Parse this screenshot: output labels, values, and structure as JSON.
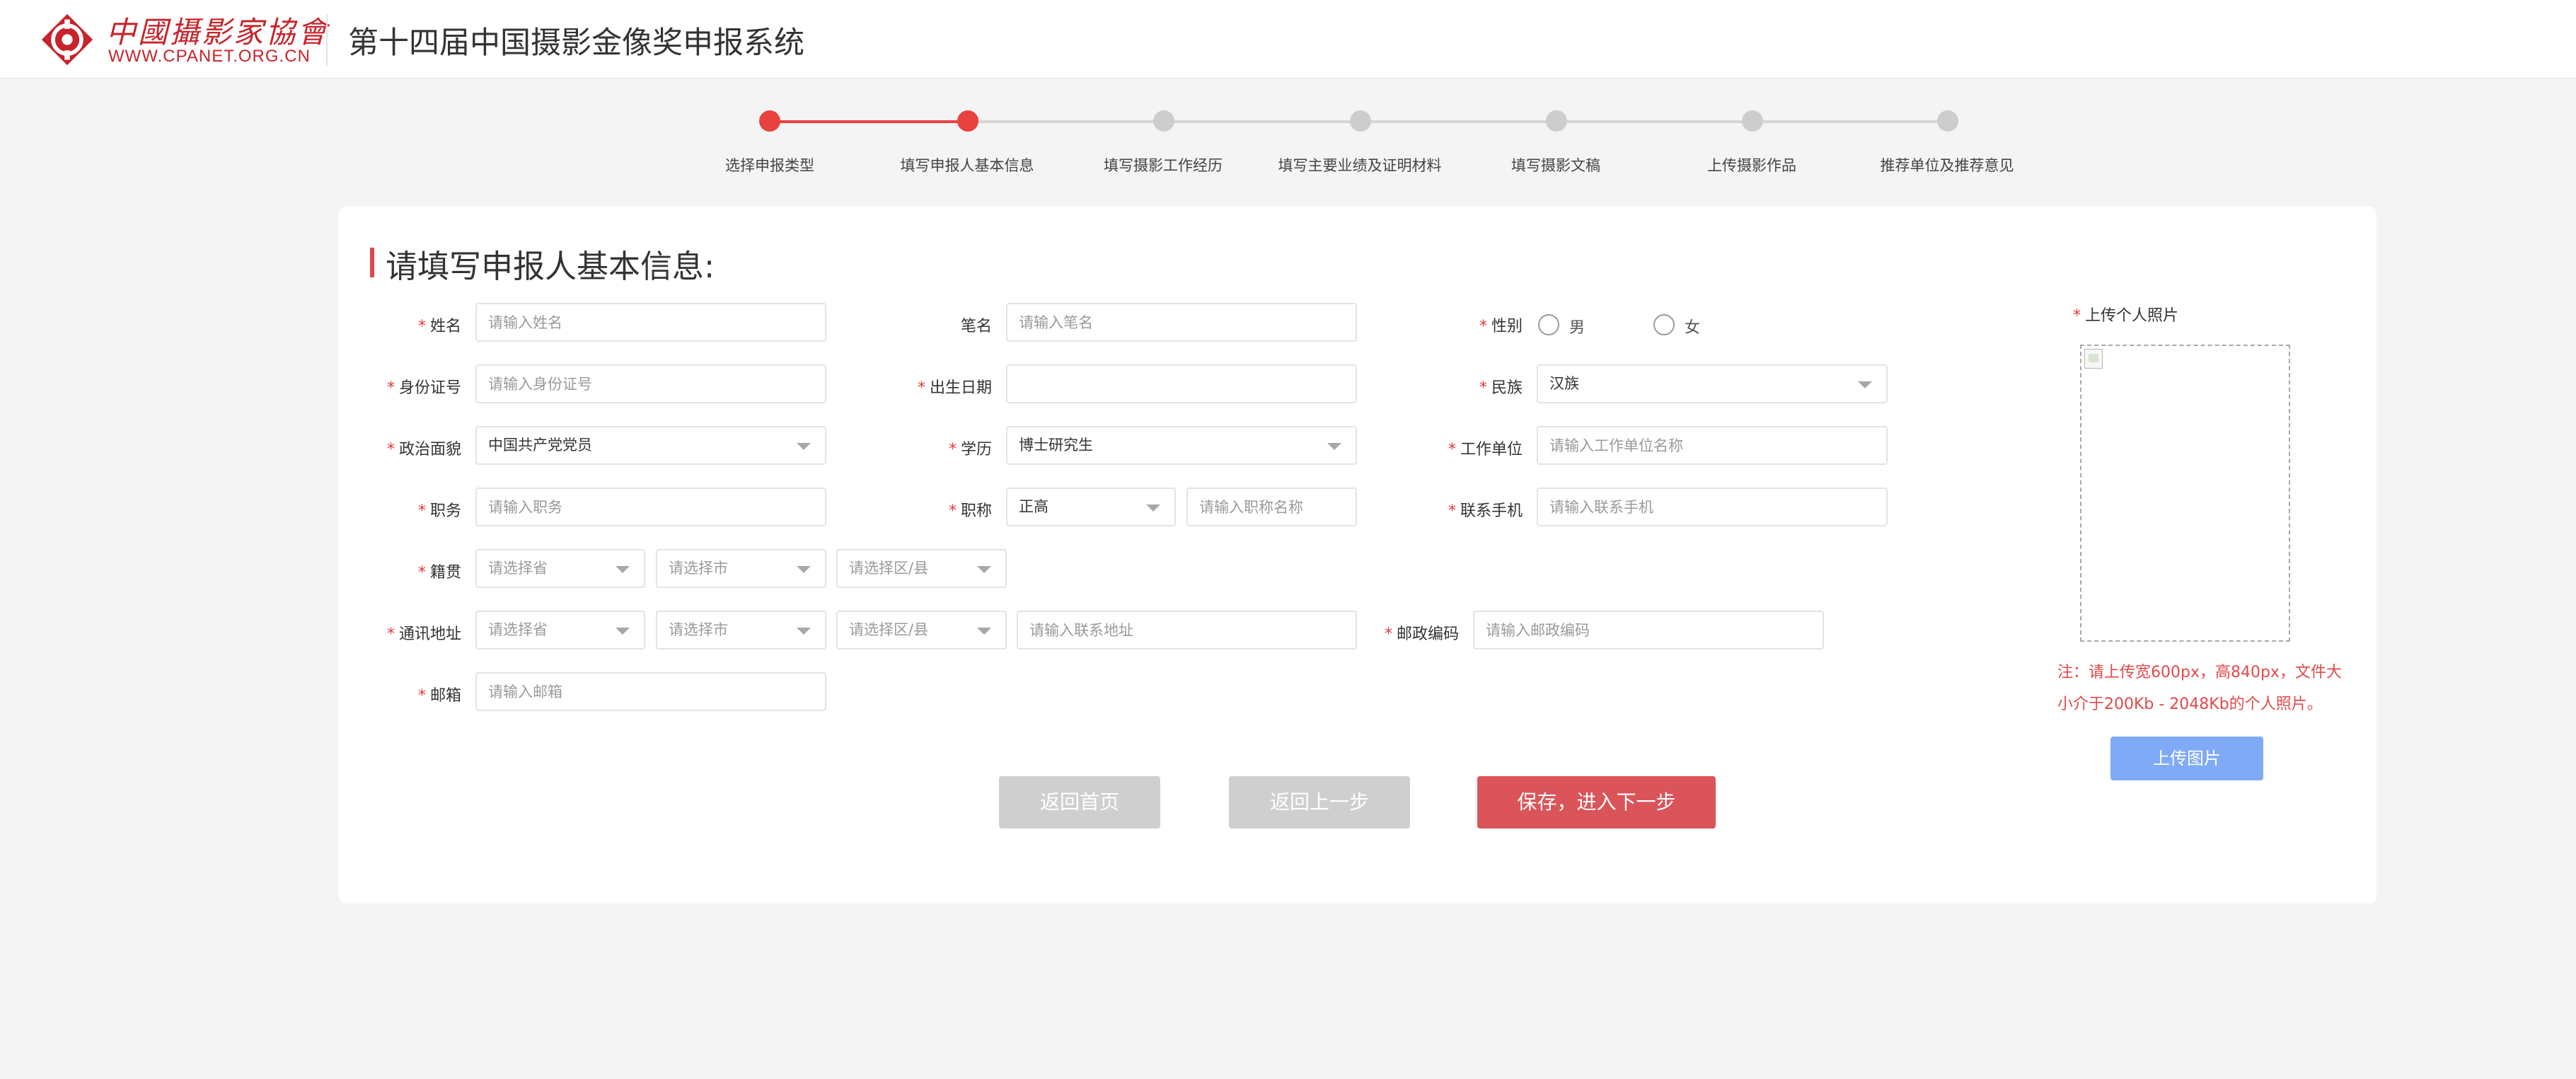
{
  "header": {
    "logo_cn": "中國攝影家協會",
    "logo_en": "WWW.CPANET.ORG.CN",
    "system_title": "第十四届中国摄影金像奖申报系统"
  },
  "steps": [
    {
      "label": "选择申报类型",
      "status": "completed"
    },
    {
      "label": "填写申报人基本信息",
      "status": "current"
    },
    {
      "label": "填写摄影工作经历",
      "status": "pending"
    },
    {
      "label": "填写主要业绩及证明材料",
      "status": "pending"
    },
    {
      "label": "填写摄影文稿",
      "status": "pending"
    },
    {
      "label": "上传摄影作品",
      "status": "pending"
    },
    {
      "label": "推荐单位及推荐意见",
      "status": "pending"
    }
  ],
  "form": {
    "title": "请填写申报人基本信息:",
    "required_mark": "*",
    "name": {
      "label": "姓名",
      "placeholder": "请输入姓名"
    },
    "pen_name": {
      "label": "笔名",
      "placeholder": "请输入笔名"
    },
    "gender": {
      "label": "性别",
      "options": [
        "男",
        "女"
      ]
    },
    "id_number": {
      "label": "身份证号",
      "placeholder": "请输入身份证号"
    },
    "birth_date": {
      "label": "出生日期",
      "value": ""
    },
    "ethnicity": {
      "label": "民族",
      "value": "汉族"
    },
    "political_status": {
      "label": "政治面貌",
      "value": "中国共产党党员"
    },
    "education": {
      "label": "学历",
      "value": "博士研究生"
    },
    "work_unit": {
      "label": "工作单位",
      "placeholder": "请输入工作单位名称"
    },
    "position": {
      "label": "职务",
      "placeholder": "请输入职务"
    },
    "title_rank": {
      "label": "职称",
      "value": "正高",
      "placeholder": "请输入职称名称"
    },
    "mobile": {
      "label": "联系手机",
      "placeholder": "请输入联系手机"
    },
    "native_place": {
      "label": "籍贯",
      "province": "请选择省",
      "city": "请选择市",
      "district": "请选择区/县"
    },
    "address": {
      "label": "通讯地址",
      "province": "请选择省",
      "city": "请选择市",
      "district": "请选择区/县",
      "placeholder": "请输入联系地址"
    },
    "postcode": {
      "label": "邮政编码",
      "placeholder": "请输入邮政编码"
    },
    "email": {
      "label": "邮箱",
      "placeholder": "请输入邮箱"
    }
  },
  "photo": {
    "label": "上传个人照片",
    "note_line1": "注：请上传宽600px，高840px，文件大",
    "note_line2": "小介于200Kb - 2048Kb的个人照片。",
    "upload_button": "上传图片"
  },
  "buttons": {
    "home": "返回首页",
    "prev": "返回上一步",
    "save_next": "保存，进入下一步"
  },
  "colors": {
    "accent_red": "#e9413f",
    "brand_red": "#c8232a",
    "primary_button": "#da5459",
    "upload_button": "#80aaf6",
    "disabled_button": "#cfcfcf"
  }
}
